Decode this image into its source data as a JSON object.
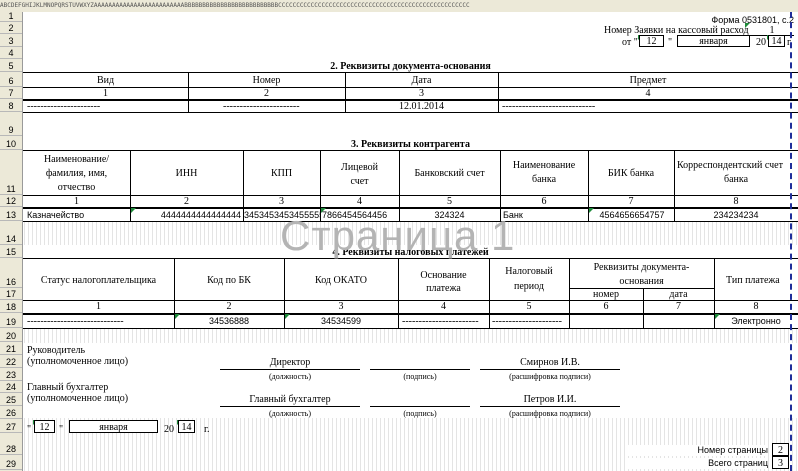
{
  "app": {
    "column_header": "ABCDEFGHIJKLMNOPQRSTUVWXYZAAAAAAAAAAAAAAAAAAAAAAAAABBBBBBBBBBBBBBBBBBBBBBBBBBCCCCCCCCCCCCCCCCCCCCCCCCCCCCCCCCCCCCCCCCCCCCCCCCCCCCC",
    "watermark": "Страница 1",
    "row_numbers": [
      "1",
      "2",
      "3",
      "4",
      "5",
      "6",
      "7",
      "8",
      "9",
      "10",
      "11",
      "12",
      "13",
      "14",
      "15",
      "16",
      "17",
      "18",
      "19",
      "20",
      "21",
      "22",
      "23",
      "24",
      "25",
      "26",
      "27",
      "28",
      "29"
    ]
  },
  "header": {
    "form_code": "Форма 0531801, с.2",
    "request_label": "Номер Заявки на кассовый расход",
    "request_number": "1",
    "from_label": "от \"",
    "day": "12",
    "quote_close": "\"",
    "month": "января",
    "year_prefix": "20",
    "year_suffix": "14",
    "year_unit": "г."
  },
  "section2": {
    "title": "2. Реквизиты документа-основания",
    "columns": [
      "Вид",
      "Номер",
      "Дата",
      "Предмет"
    ],
    "numbers": [
      "1",
      "2",
      "3",
      "4"
    ],
    "row": [
      "----------------------",
      "-----------------------",
      "12.01.2014",
      "----------------------------"
    ]
  },
  "section3": {
    "title": "3. Реквизиты контрагента",
    "columns": [
      "Наименование/ фамилия, имя, отчество",
      "ИНН",
      "КПП",
      "Лицевой счет",
      "Банковский счет",
      "Наименование банка",
      "БИК банка",
      "Корреспондентский счет банка"
    ],
    "col1_lines": [
      "Наименование/",
      "фамилия, имя,",
      "отчество"
    ],
    "col4_lines": [
      "Лицевой",
      "счет"
    ],
    "col6_lines": [
      "Наименование",
      "банка"
    ],
    "col8_lines": [
      "Корреспондентский счет",
      "банка"
    ],
    "numbers": [
      "1",
      "2",
      "3",
      "4",
      "5",
      "6",
      "7",
      "8"
    ],
    "row": [
      "Казначейство",
      "4444444444444444",
      "3453453453455555",
      "7866454564456",
      "324324",
      "Банк",
      "4564656654757",
      "234234234"
    ]
  },
  "section4": {
    "title": "4. Реквизиты налоговых платежей",
    "columns": [
      "Статус налогоплательщика",
      "Код по БК",
      "Код ОКАТО",
      "Основание платежа",
      "Налоговый период",
      "Реквизиты документа-оснований",
      "номер",
      "дата",
      "Тип платежа"
    ],
    "col4_lines": [
      "Основание",
      "платежа"
    ],
    "col5_lines": [
      "Налоговый",
      "период"
    ],
    "col6_lines": [
      "Реквизиты документа-",
      "основания"
    ],
    "numbers": [
      "1",
      "2",
      "3",
      "4",
      "5",
      "6",
      "7",
      "8"
    ],
    "row": [
      "-----------------------------",
      "34536888",
      "34534599",
      "-----------------------",
      "---------------------",
      "",
      "",
      "Электронно"
    ]
  },
  "signatures": {
    "head_label_1": "Руководитель",
    "head_label_2": "(уполномоченное лицо)",
    "head_position": "Директор",
    "head_name": "Смирнов И.В.",
    "accountant_label_1": "Главный бухгалтер",
    "accountant_label_2": "(уполномоченное лицо)",
    "accountant_position": "Главный бухгалтер",
    "accountant_name": "Петров И.И.",
    "caption_position": "(должность)",
    "caption_signature": "(подпись)",
    "caption_decoding": "(расшифровка подписи)"
  },
  "footer": {
    "quote_open": "\"",
    "day": "12",
    "quote_close": "\"",
    "month": "января",
    "year_prefix": "20",
    "year_suffix": "14",
    "year_unit": "г.",
    "page_number_label": "Номер страницы",
    "page_number": "2",
    "total_pages_label": "Всего страниц",
    "total_pages": "3"
  }
}
